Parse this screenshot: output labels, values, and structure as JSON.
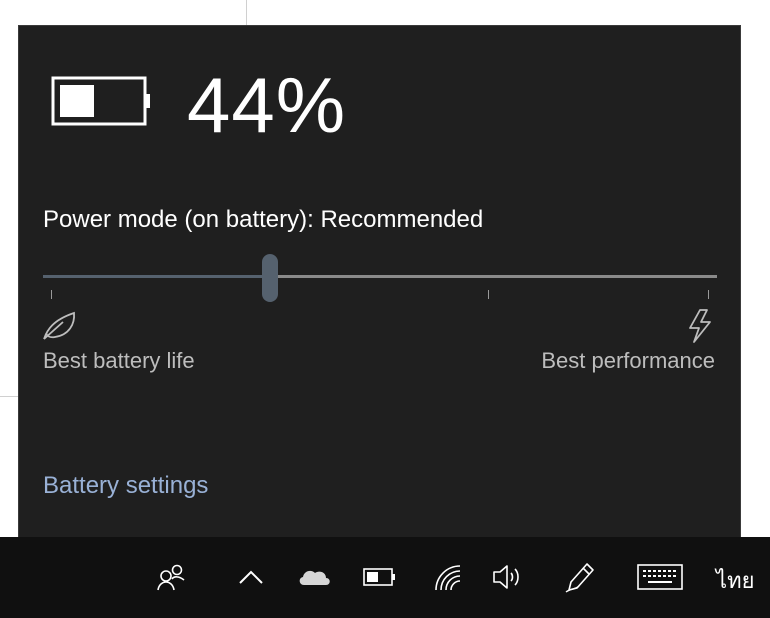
{
  "flyout": {
    "battery_percent_label": "44%",
    "battery_level": 0.44,
    "power_mode_label": "Power mode (on battery): Recommended",
    "slider_position": 0.33,
    "slider_left_label": "Best battery life",
    "slider_right_label": "Best performance",
    "settings_link": "Battery settings"
  },
  "taskbar": {
    "icons": [
      "people-icon",
      "chevron-up-icon",
      "onedrive-cloud-icon",
      "battery-icon",
      "wifi-icon",
      "volume-icon",
      "pen-icon",
      "keyboard-icon"
    ],
    "language_label": "ไทย"
  },
  "colors": {
    "flyout_bg": "#1f1f1f",
    "taskbar_bg": "#101010",
    "accent": "#55616e",
    "link": "#99b1d6"
  }
}
